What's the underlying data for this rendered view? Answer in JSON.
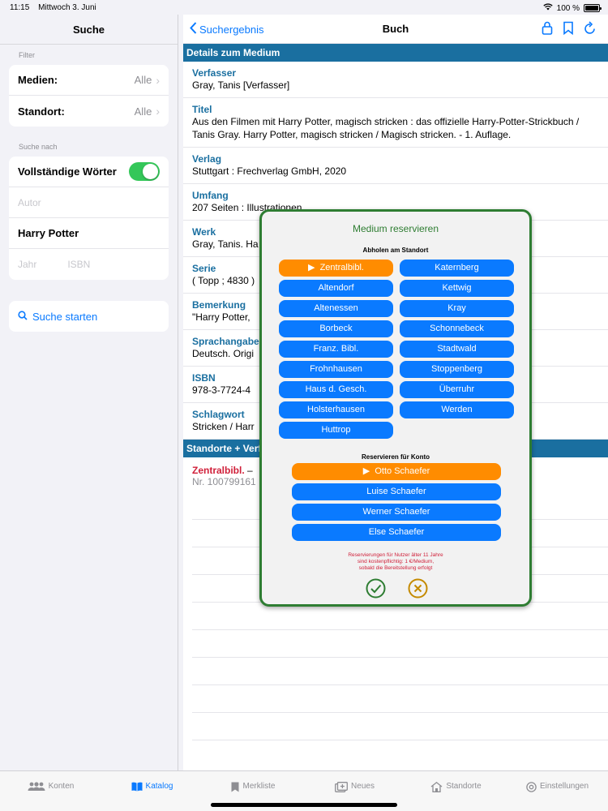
{
  "status": {
    "time": "11:15",
    "date": "Mittwoch 3. Juni",
    "battery": "100 %"
  },
  "left": {
    "title": "Suche",
    "filter_label": "Filter",
    "filters": [
      {
        "label": "Medien:",
        "value": "Alle"
      },
      {
        "label": "Standort:",
        "value": "Alle"
      }
    ],
    "search_by_label": "Suche nach",
    "full_words_label": "Vollständige Wörter",
    "full_words_on": true,
    "author_placeholder": "Autor",
    "title_value": "Harry Potter",
    "year_placeholder": "Jahr",
    "isbn_placeholder": "ISBN",
    "search_button": "Suche starten"
  },
  "right": {
    "back_label": "Suchergebnis",
    "title": "Buch",
    "details_header": "Details zum Medium",
    "fields": [
      {
        "label": "Verfasser",
        "value": "Gray, Tanis [Verfasser]"
      },
      {
        "label": "Titel",
        "value": "Aus den Filmen mit Harry Potter, magisch stricken : das offizielle Harry-Potter-Strickbuch / Tanis Gray. Harry Potter, magisch stricken / Magisch stricken. - 1. Auflage."
      },
      {
        "label": "Verlag",
        "value": "Stuttgart : Frechverlag GmbH, 2020"
      },
      {
        "label": "Umfang",
        "value": "207 Seiten : Illustrationen"
      },
      {
        "label": "Werk",
        "value": "Gray, Tanis. Ha"
      },
      {
        "label": "Serie",
        "value": "( Topp ; 4830 )"
      },
      {
        "label": "Bemerkung",
        "value": "\"Harry Potter, "
      },
      {
        "label": "Sprachangabe",
        "value": "Deutsch. Origi"
      },
      {
        "label": "ISBN",
        "value": "978-3-7724-4"
      },
      {
        "label": "Schlagwort",
        "value": "Stricken  / Harr"
      }
    ],
    "locations_header": "Standorte + Verfügbarkeit",
    "location": {
      "name": "Zentralbibl.",
      "dash": "–",
      "number": "Nr. 100799161"
    }
  },
  "modal": {
    "title": "Medium reservieren",
    "pickup_label": "Abholen am Standort",
    "locations": [
      {
        "name": "Zentralbibl.",
        "selected": true
      },
      {
        "name": "Katernberg",
        "selected": false
      },
      {
        "name": "Altendorf",
        "selected": false
      },
      {
        "name": "Kettwig",
        "selected": false
      },
      {
        "name": "Altenessen",
        "selected": false
      },
      {
        "name": "Kray",
        "selected": false
      },
      {
        "name": "Borbeck",
        "selected": false
      },
      {
        "name": "Schonnebeck",
        "selected": false
      },
      {
        "name": "Franz. Bibl.",
        "selected": false
      },
      {
        "name": "Stadtwald",
        "selected": false
      },
      {
        "name": "Frohnhausen",
        "selected": false
      },
      {
        "name": "Stoppenberg",
        "selected": false
      },
      {
        "name": "Haus d. Gesch.",
        "selected": false
      },
      {
        "name": "Überruhr",
        "selected": false
      },
      {
        "name": "Holsterhausen",
        "selected": false
      },
      {
        "name": "Werden",
        "selected": false
      },
      {
        "name": "Huttrop",
        "selected": false
      }
    ],
    "account_label": "Reservieren für Konto",
    "accounts": [
      {
        "name": "Otto Schaefer",
        "selected": true
      },
      {
        "name": "Luise Schaefer",
        "selected": false
      },
      {
        "name": "Werner Schaefer",
        "selected": false
      },
      {
        "name": "Else Schaefer",
        "selected": false
      }
    ],
    "note_lines": [
      "Reservierungen für Nutzer älter 11 Jahre",
      "sind kostenpflichtig: 1 €/Medium,",
      "sobald die Bereitstellung erfolgt"
    ],
    "selected_marker": "▶"
  },
  "tabs": [
    {
      "label": "Konten",
      "icon": "people-icon",
      "active": false
    },
    {
      "label": "Katalog",
      "icon": "book-icon",
      "active": true
    },
    {
      "label": "Merkliste",
      "icon": "bookmark-icon",
      "active": false
    },
    {
      "label": "Neues",
      "icon": "new-icon",
      "active": false
    },
    {
      "label": "Standorte",
      "icon": "house-icon",
      "active": false
    },
    {
      "label": "Einstellungen",
      "icon": "gear-icon",
      "active": false
    }
  ],
  "colors": {
    "accent": "#0a7aff",
    "selected": "#ff8c00",
    "header": "#1a6fa0",
    "modal_border": "#2e7d32",
    "note": "#d0203a"
  }
}
